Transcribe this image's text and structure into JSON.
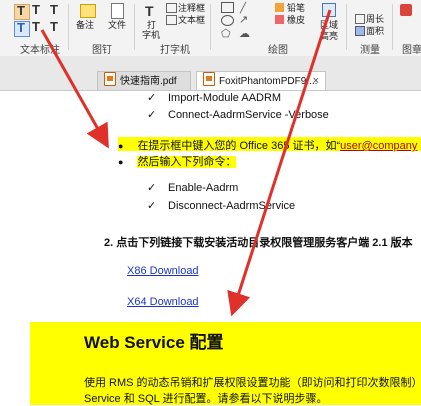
{
  "ribbon": {
    "groups": {
      "text_tag": "文本标注",
      "drawing": "图钉",
      "typewriter": "打字机",
      "drawing2": "绘图",
      "measure": "测量",
      "stamp": "图章"
    },
    "buttons": {
      "note": "备注",
      "file": "文件",
      "typewriter_a": "打",
      "typewriter_b": "字机",
      "annotation": "注释框",
      "textbox": "文本框",
      "pencil": "铅笔",
      "eraser": "橡皮",
      "area_a": "区域",
      "area_b": "高亮",
      "perimeter": "周长",
      "area_measure": "面积"
    }
  },
  "tabs": [
    {
      "label": "快速指南.pdf"
    },
    {
      "label": "FoxitPhantomPDF9....",
      "close": "×"
    }
  ],
  "document": {
    "bullets_top": [
      "Import-Module AADRM",
      "Connect-AadrmService -Verbose"
    ],
    "dot_items": [
      {
        "text": "在提示框中键入您的 Office 365 证书，如“",
        "link": "user@company"
      },
      {
        "text": "然后输入下列命令："
      }
    ],
    "bullets_mid": [
      "Enable-Aadrm",
      "Disconnect-AadrmService"
    ],
    "step2": "2.   点击下列链接下载安装活动目录权限管理服务客户端 2.1 版本",
    "x86": "X86 Download",
    "x64": "X64 Download",
    "section_title": "Web Service 配置",
    "para1": "使用 RMS 的动态吊销和扩展权限设置功能（即访问和打印次数限制）前",
    "para2": "Service 和 SQL 进行配置。请参看以下说明步骤。"
  },
  "colors": {
    "highlight": "#ffff00",
    "arrow": "#e0302a",
    "link": "#1a35c8"
  }
}
